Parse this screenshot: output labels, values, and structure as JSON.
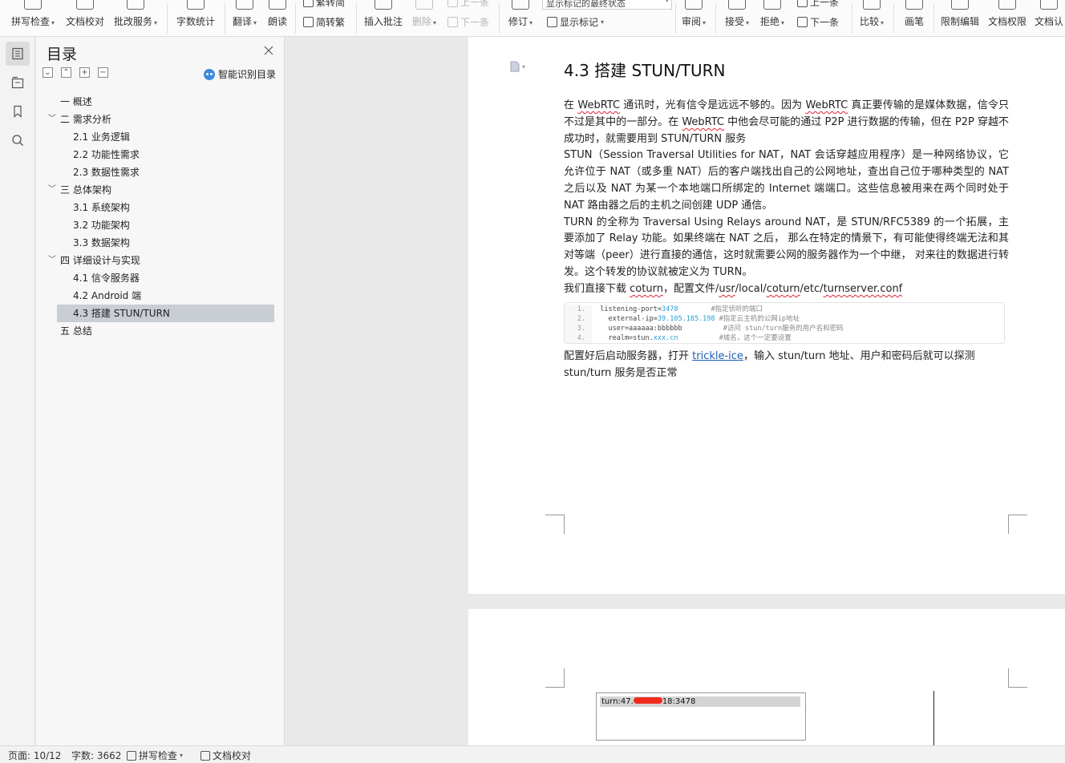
{
  "ribbon": {
    "buttons": [
      {
        "label": "拼写检查",
        "caret": true,
        "icon": "spellcheck-icon"
      },
      {
        "label": "文档校对",
        "caret": false,
        "icon": "doc-proofread-icon"
      },
      {
        "label": "批改服务",
        "caret": true,
        "icon": "correction-service-icon"
      },
      {
        "label": "字数统计",
        "caret": false,
        "icon": "word-count-icon"
      },
      {
        "label": "翻译",
        "caret": true,
        "icon": "translate-icon"
      },
      {
        "label": "朗读",
        "caret": false,
        "icon": "read-aloud-icon"
      },
      {
        "label": "插入批注",
        "caret": false,
        "icon": "insert-comment-icon"
      },
      {
        "label": "删除",
        "caret": true,
        "icon": "delete-comment-icon",
        "disabled": true
      },
      {
        "label": "修订",
        "caret": true,
        "icon": "track-changes-icon"
      },
      {
        "label": "审阅",
        "caret": true,
        "icon": "review-icon"
      },
      {
        "label": "接受",
        "caret": true,
        "icon": "accept-icon"
      },
      {
        "label": "拒绝",
        "caret": true,
        "icon": "reject-icon"
      },
      {
        "label": "比较",
        "caret": true,
        "icon": "compare-icon"
      },
      {
        "label": "画笔",
        "caret": false,
        "icon": "pen-icon"
      },
      {
        "label": "限制编辑",
        "caret": false,
        "icon": "restrict-edit-icon"
      },
      {
        "label": "文档权限",
        "caret": false,
        "icon": "doc-permission-icon"
      },
      {
        "label": "文档认",
        "caret": false,
        "icon": "doc-auth-icon"
      }
    ],
    "small": {
      "trad_simp": "繁转简",
      "simp_trad": "简转繁",
      "prev_comment": "上一条",
      "next_comment": "下一条",
      "show_markup": "显示标记",
      "next_change": "下一条",
      "prev_change": "上一条"
    },
    "markup_combo": "显示标记的最终状态"
  },
  "rail": {
    "icons": [
      "toc-icon",
      "navigation-icon",
      "bookmark-icon",
      "search-icon"
    ]
  },
  "toc": {
    "title": "目录",
    "smart_label": "智能识别目录",
    "items": [
      {
        "text": "一  概述",
        "level": 1,
        "toggle": ""
      },
      {
        "text": "二  需求分析",
        "level": 1,
        "toggle": "﹀"
      },
      {
        "text": "2.1  业务逻辑",
        "level": 2,
        "toggle": ""
      },
      {
        "text": "2.2  功能性需求",
        "level": 2,
        "toggle": ""
      },
      {
        "text": "2.3  数据性需求",
        "level": 2,
        "toggle": ""
      },
      {
        "text": "三  总体架构",
        "level": 1,
        "toggle": "﹀"
      },
      {
        "text": "3.1  系统架构",
        "level": 2,
        "toggle": ""
      },
      {
        "text": "3.2  功能架构",
        "level": 2,
        "toggle": ""
      },
      {
        "text": "3.3  数据架构",
        "level": 2,
        "toggle": ""
      },
      {
        "text": "四  详细设计与实现",
        "level": 1,
        "toggle": "﹀"
      },
      {
        "text": "4.1  信令服务器",
        "level": 2,
        "toggle": ""
      },
      {
        "text": "4.2 Android 端",
        "level": 2,
        "toggle": ""
      },
      {
        "text": "4.3  搭建  STUN/TURN",
        "level": 2,
        "toggle": "",
        "selected": true
      },
      {
        "text": "五  总结",
        "level": 1,
        "toggle": ""
      }
    ]
  },
  "document": {
    "heading": "4.3  搭建  STUN/TURN",
    "p1": {
      "a": "在 ",
      "w1": "WebRTC",
      "b": " 通讯时，光有信令是远远不够的。因为 ",
      "w2": "WebRTC",
      "c": " 真正要传输的是媒体数据，信令只不过是其中的一部分。在 ",
      "w3": "WebRTC",
      "d": " 中他会尽可能的通过 P2P 进行数据的传输，但在 P2P 穿越不成功时，就需要用到 STUN/TURN 服务"
    },
    "p2": "STUN（Session Traversal Utilities for NAT，NAT 会话穿越应用程序）是一种网络协议，它允许位于 NAT（或多重 NAT）后的客户端找出自己的公网地址，查出自己位于哪种类型的 NAT 之后以及 NAT 为某一个本地端口所绑定的 Internet 端端口。这些信息被用来在两个同时处于 NAT 路由器之后的主机之间创建 UDP 通信。",
    "p3": "TURN 的全称为 Traversal Using Relays around NAT，是 STUN/RFC5389 的一个拓展，主要添加了 Relay 功能。如果终端在 NAT 之后，  那么在特定的情景下，有可能使得终端无法和其对等端（peer）进行直接的通信，这时就需要公网的服务器作为一个中继，  对来往的数据进行转发。这个转发的协议就被定义为 TURN。",
    "p4": {
      "a": "我们直接下载 ",
      "w1": "coturn",
      "b": "，配置文件/",
      "w2": "usr",
      "c": "/local/",
      "w3": "coturn",
      "d": "/etc/",
      "w4": "turnserver.conf"
    },
    "code": [
      {
        "n": "1.",
        "key": "  listening-port=",
        "val": "3478",
        "pad": "        ",
        "cmt": "#指定侦听的端口"
      },
      {
        "n": "2.",
        "key": "    external-ip=",
        "val": "39.105.185.198",
        "pad": " ",
        "cmt": "#指定云主机的公网ip地址"
      },
      {
        "n": "3.",
        "key": "    user=aaaaaa:bbbbbb",
        "val": "",
        "pad": "          ",
        "cmt": "#访问 stun/turn服务的用户名和密码"
      },
      {
        "n": "4.",
        "key": "    realm=stun.",
        "val": "xxx.cn",
        "pad": "          ",
        "cmt": "#域名，这个一定要设置"
      }
    ],
    "p5": {
      "a": "配置好后启动服务器，打开 ",
      "link": "trickle-ice",
      "b": "，输入 stun/turn 地址、用户和密码后就可以探测 stun/turn 服务是否正常"
    },
    "page2_field_prefix": "turn:47.",
    "page2_field_suffix": "18:3478"
  },
  "status": {
    "page": "页面: 10/12",
    "words": "字数: 3662",
    "spell": "拼写检查",
    "proof": "文档校对"
  }
}
